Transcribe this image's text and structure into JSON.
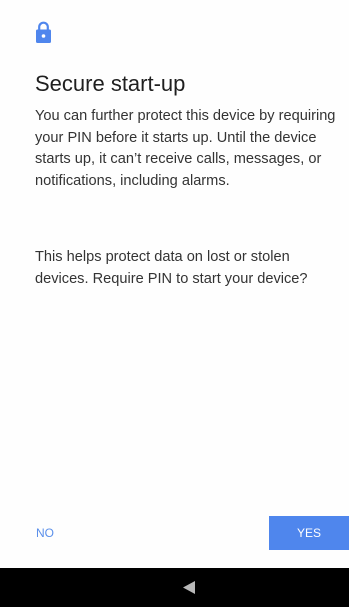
{
  "dialog": {
    "title": "Secure start-up",
    "paragraph_1": "You can further protect this device by requiring your PIN before it starts up. Until the device starts up, it can’t receive calls, messages, or notifications, including alarms.",
    "paragraph_2": "This helps protect data on lost or stolen devices. Require PIN to start your device?",
    "no_label": "NO",
    "yes_label": "YES"
  },
  "icons": {
    "header_icon": "lock-icon",
    "nav_back": "back-icon"
  },
  "colors": {
    "accent": "#4f86ed",
    "no_text": "#5a8fea",
    "navbar": "#000000"
  }
}
